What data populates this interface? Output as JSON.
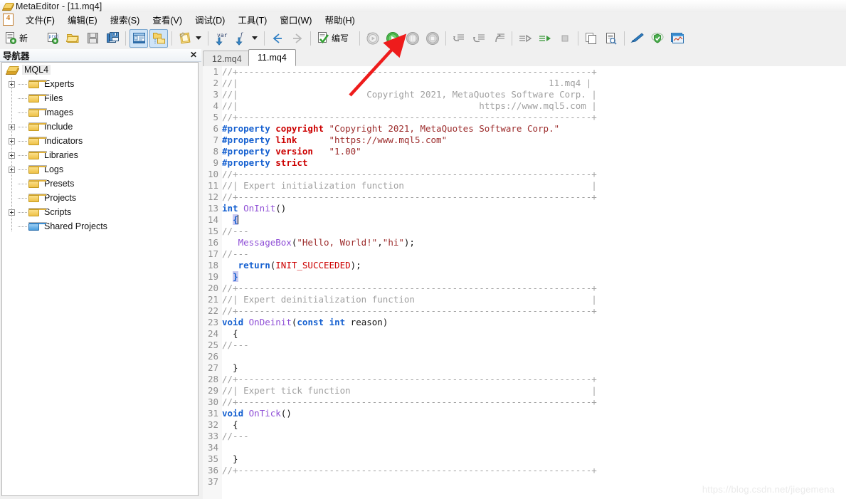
{
  "window": {
    "title": "MetaEditor - [11.mq4]",
    "icon": "metaeditor-app-icon"
  },
  "menu": {
    "project_badge": "4",
    "items": [
      {
        "label": "文件(F)",
        "name": "menu-file"
      },
      {
        "label": "编辑(E)",
        "name": "menu-edit"
      },
      {
        "label": "搜索(S)",
        "name": "menu-search"
      },
      {
        "label": "查看(V)",
        "name": "menu-view"
      },
      {
        "label": "调试(D)",
        "name": "menu-debug"
      },
      {
        "label": "工具(T)",
        "name": "menu-tools"
      },
      {
        "label": "窗口(W)",
        "name": "menu-window"
      },
      {
        "label": "帮助(H)",
        "name": "menu-help"
      }
    ]
  },
  "toolbar": {
    "new_label": "新",
    "compile_label": "编写",
    "buttons": [
      {
        "name": "new-file-button",
        "icon": "new-document-icon"
      },
      {
        "name": "new-project-button",
        "icon": "new-project-icon"
      },
      {
        "name": "open-button",
        "icon": "open-folder-icon"
      },
      {
        "name": "save-button",
        "icon": "floppy-save-icon"
      },
      {
        "name": "save-all-button",
        "icon": "floppy-save-all-icon"
      },
      {
        "name": "toggle-navigator-button",
        "icon": "panel-layout-icon"
      },
      {
        "name": "toggle-toolbox-button",
        "icon": "folder-tree-icon"
      },
      {
        "name": "style-button",
        "icon": "notepad-pencil-icon"
      },
      {
        "name": "style-dropdown",
        "icon": "chevron-down-icon"
      },
      {
        "name": "insert-variable-button",
        "icon": "var-arrow-icon"
      },
      {
        "name": "insert-function-button",
        "icon": "function-arrow-icon"
      },
      {
        "name": "insert-function-dropdown",
        "icon": "chevron-down-icon"
      },
      {
        "name": "navigate-back-button",
        "icon": "arrow-left-icon"
      },
      {
        "name": "navigate-forward-button",
        "icon": "arrow-right-icon"
      },
      {
        "name": "compile-button",
        "icon": "compile-check-icon"
      },
      {
        "name": "restart-debug-button",
        "icon": "restart-circle-icon"
      },
      {
        "name": "start-debug-button",
        "icon": "play-circle-icon"
      },
      {
        "name": "pause-debug-button",
        "icon": "pause-circle-icon"
      },
      {
        "name": "stop-debug-button",
        "icon": "stop-circle-icon"
      },
      {
        "name": "step-into-button",
        "icon": "step-into-icon"
      },
      {
        "name": "step-over-button",
        "icon": "step-over-icon"
      },
      {
        "name": "step-out-button",
        "icon": "step-out-icon"
      },
      {
        "name": "run-to-cursor-button",
        "icon": "run-to-cursor-icon"
      },
      {
        "name": "start-profiling-button",
        "icon": "profiling-play-icon"
      },
      {
        "name": "stop-profiling-button",
        "icon": "profiling-stop-icon"
      },
      {
        "name": "copy-button",
        "icon": "copy-pages-icon"
      },
      {
        "name": "find-in-files-button",
        "icon": "document-search-icon"
      },
      {
        "name": "mql5-community-button",
        "icon": "pen-icon"
      },
      {
        "name": "mql5-cloud-button",
        "icon": "cloud-shield-icon"
      },
      {
        "name": "charts-button",
        "icon": "charts-window-icon"
      }
    ]
  },
  "navigator": {
    "title": "导航器",
    "close_label": "✕",
    "root": {
      "label": "MQL4",
      "icon": "mql4-root-icon"
    },
    "items": [
      {
        "label": "Experts",
        "expandable": true,
        "folder": "yellow"
      },
      {
        "label": "Files",
        "expandable": false,
        "folder": "yellow"
      },
      {
        "label": "Images",
        "expandable": false,
        "folder": "yellow"
      },
      {
        "label": "Include",
        "expandable": true,
        "folder": "yellow"
      },
      {
        "label": "Indicators",
        "expandable": true,
        "folder": "yellow"
      },
      {
        "label": "Libraries",
        "expandable": true,
        "folder": "yellow"
      },
      {
        "label": "Logs",
        "expandable": true,
        "folder": "yellow"
      },
      {
        "label": "Presets",
        "expandable": false,
        "folder": "yellow"
      },
      {
        "label": "Projects",
        "expandable": false,
        "folder": "yellow"
      },
      {
        "label": "Scripts",
        "expandable": true,
        "folder": "yellow"
      },
      {
        "label": "Shared Projects",
        "expandable": false,
        "folder": "blue"
      }
    ]
  },
  "editor": {
    "tabs": [
      {
        "label": "12.mq4",
        "active": false
      },
      {
        "label": "11.mq4",
        "active": true
      }
    ],
    "lines": [
      {
        "n": 1,
        "segments": [
          {
            "t": "com",
            "s": "//+------------------------------------------------------------------+"
          }
        ]
      },
      {
        "n": 2,
        "segments": [
          {
            "t": "com",
            "s": "//|                                                          11.mq4 |"
          }
        ]
      },
      {
        "n": 3,
        "segments": [
          {
            "t": "com",
            "s": "//|                        Copyright 2021, MetaQuotes Software Corp. |"
          }
        ]
      },
      {
        "n": 4,
        "segments": [
          {
            "t": "com",
            "s": "//|                                             https://www.mql5.com |"
          }
        ]
      },
      {
        "n": 5,
        "segments": [
          {
            "t": "com",
            "s": "//+------------------------------------------------------------------+"
          }
        ]
      },
      {
        "n": 6,
        "segments": [
          {
            "t": "pre",
            "s": "#property"
          },
          {
            "t": "pun",
            "s": " "
          },
          {
            "t": "key",
            "s": "copyright"
          },
          {
            "t": "pun",
            "s": " "
          },
          {
            "t": "str",
            "s": "\"Copyright 2021, MetaQuotes Software Corp.\""
          }
        ]
      },
      {
        "n": 7,
        "segments": [
          {
            "t": "pre",
            "s": "#property"
          },
          {
            "t": "pun",
            "s": " "
          },
          {
            "t": "key",
            "s": "link"
          },
          {
            "t": "pun",
            "s": "      "
          },
          {
            "t": "str",
            "s": "\"https://www.mql5.com\""
          }
        ]
      },
      {
        "n": 8,
        "segments": [
          {
            "t": "pre",
            "s": "#property"
          },
          {
            "t": "pun",
            "s": " "
          },
          {
            "t": "key",
            "s": "version"
          },
          {
            "t": "pun",
            "s": "   "
          },
          {
            "t": "str",
            "s": "\"1.00\""
          }
        ]
      },
      {
        "n": 9,
        "segments": [
          {
            "t": "pre",
            "s": "#property"
          },
          {
            "t": "pun",
            "s": " "
          },
          {
            "t": "key",
            "s": "strict"
          }
        ]
      },
      {
        "n": 10,
        "segments": [
          {
            "t": "com",
            "s": "//+------------------------------------------------------------------+"
          }
        ]
      },
      {
        "n": 11,
        "segments": [
          {
            "t": "com",
            "s": "//| Expert initialization function                                   |"
          }
        ]
      },
      {
        "n": 12,
        "segments": [
          {
            "t": "com",
            "s": "//+------------------------------------------------------------------+"
          }
        ]
      },
      {
        "n": 13,
        "segments": [
          {
            "t": "type",
            "s": "int"
          },
          {
            "t": "pun",
            "s": " "
          },
          {
            "t": "fn",
            "s": "OnInit"
          },
          {
            "t": "pun",
            "s": "()"
          }
        ]
      },
      {
        "n": 14,
        "segments": [
          {
            "t": "pun",
            "s": "  "
          },
          {
            "t": "hl",
            "s": "{"
          },
          {
            "t": "caret",
            "s": ""
          }
        ]
      },
      {
        "n": 15,
        "segments": [
          {
            "t": "com",
            "s": "//---"
          }
        ]
      },
      {
        "n": 16,
        "segments": [
          {
            "t": "pun",
            "s": "   "
          },
          {
            "t": "fn",
            "s": "MessageBox"
          },
          {
            "t": "pun",
            "s": "("
          },
          {
            "t": "str",
            "s": "\"Hello, World!\""
          },
          {
            "t": "pun",
            "s": ","
          },
          {
            "t": "str",
            "s": "\"hi\""
          },
          {
            "t": "pun",
            "s": ");"
          }
        ]
      },
      {
        "n": 17,
        "segments": [
          {
            "t": "com",
            "s": "//---"
          }
        ]
      },
      {
        "n": 18,
        "segments": [
          {
            "t": "pun",
            "s": "   "
          },
          {
            "t": "type",
            "s": "return"
          },
          {
            "t": "pun",
            "s": "("
          },
          {
            "t": "const",
            "s": "INIT_SUCCEEDED"
          },
          {
            "t": "pun",
            "s": ");"
          }
        ]
      },
      {
        "n": 19,
        "segments": [
          {
            "t": "pun",
            "s": "  "
          },
          {
            "t": "hl",
            "s": "}"
          }
        ]
      },
      {
        "n": 20,
        "segments": [
          {
            "t": "com",
            "s": "//+------------------------------------------------------------------+"
          }
        ]
      },
      {
        "n": 21,
        "segments": [
          {
            "t": "com",
            "s": "//| Expert deinitialization function                                 |"
          }
        ]
      },
      {
        "n": 22,
        "segments": [
          {
            "t": "com",
            "s": "//+------------------------------------------------------------------+"
          }
        ]
      },
      {
        "n": 23,
        "segments": [
          {
            "t": "type",
            "s": "void"
          },
          {
            "t": "pun",
            "s": " "
          },
          {
            "t": "fn",
            "s": "OnDeinit"
          },
          {
            "t": "pun",
            "s": "("
          },
          {
            "t": "type",
            "s": "const"
          },
          {
            "t": "pun",
            "s": " "
          },
          {
            "t": "type",
            "s": "int"
          },
          {
            "t": "pun",
            "s": " "
          },
          {
            "t": "id",
            "s": "reason"
          },
          {
            "t": "pun",
            "s": ")"
          }
        ]
      },
      {
        "n": 24,
        "segments": [
          {
            "t": "pun",
            "s": "  {"
          }
        ]
      },
      {
        "n": 25,
        "segments": [
          {
            "t": "com",
            "s": "//---"
          }
        ]
      },
      {
        "n": 26,
        "segments": [
          {
            "t": "pun",
            "s": ""
          }
        ]
      },
      {
        "n": 27,
        "segments": [
          {
            "t": "pun",
            "s": "  }"
          }
        ]
      },
      {
        "n": 28,
        "segments": [
          {
            "t": "com",
            "s": "//+------------------------------------------------------------------+"
          }
        ]
      },
      {
        "n": 29,
        "segments": [
          {
            "t": "com",
            "s": "//| Expert tick function                                             |"
          }
        ]
      },
      {
        "n": 30,
        "segments": [
          {
            "t": "com",
            "s": "//+------------------------------------------------------------------+"
          }
        ]
      },
      {
        "n": 31,
        "segments": [
          {
            "t": "type",
            "s": "void"
          },
          {
            "t": "pun",
            "s": " "
          },
          {
            "t": "fn",
            "s": "OnTick"
          },
          {
            "t": "pun",
            "s": "()"
          }
        ]
      },
      {
        "n": 32,
        "segments": [
          {
            "t": "pun",
            "s": "  {"
          }
        ]
      },
      {
        "n": 33,
        "segments": [
          {
            "t": "com",
            "s": "//---"
          }
        ]
      },
      {
        "n": 34,
        "segments": [
          {
            "t": "pun",
            "s": ""
          }
        ]
      },
      {
        "n": 35,
        "segments": [
          {
            "t": "pun",
            "s": "  }"
          }
        ]
      },
      {
        "n": 36,
        "segments": [
          {
            "t": "com",
            "s": "//+------------------------------------------------------------------+"
          }
        ]
      },
      {
        "n": 37,
        "segments": [
          {
            "t": "pun",
            "s": ""
          }
        ]
      }
    ]
  },
  "annotation": {
    "arrow_color": "#ee1c1c",
    "points_to": "start-debug-button"
  },
  "watermark": {
    "text": "https://blog.csdn.net/jiegemena"
  }
}
